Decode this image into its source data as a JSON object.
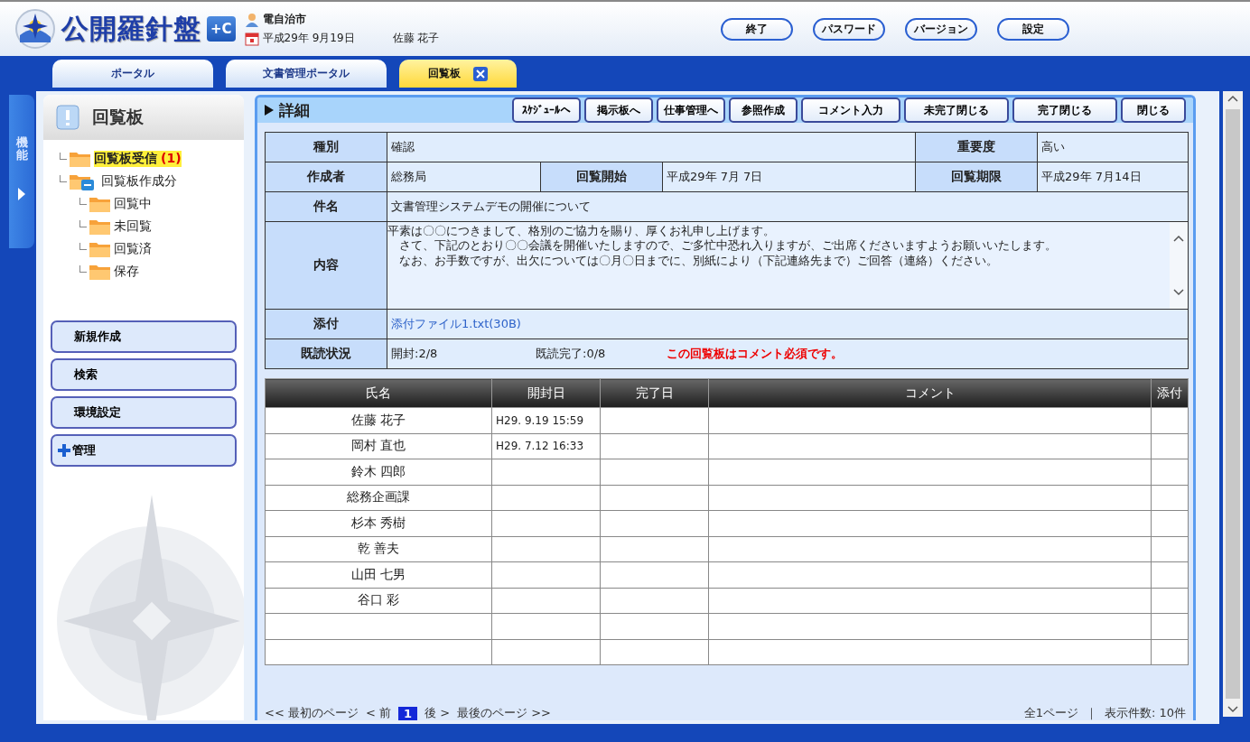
{
  "header": {
    "logo_text": "公開羅針盤",
    "logo_badge": "+C",
    "organization": "電自治市",
    "date": "平成29年 9月19日",
    "user": "佐藤 花子",
    "buttons": [
      "終了",
      "パスワード",
      "バージョン",
      "設定"
    ]
  },
  "tabs": [
    {
      "label": "ポータル",
      "selected": false,
      "closable": false
    },
    {
      "label": "文書管理ポータル",
      "selected": false,
      "closable": false
    },
    {
      "label": "回覧板",
      "selected": true,
      "closable": true
    }
  ],
  "side_strip": {
    "label": "機能"
  },
  "sidebar": {
    "title": "回覧板",
    "tree": [
      {
        "label": "回覧板受信",
        "count": "(1)",
        "highlighted": true
      },
      {
        "label": "回覧板作成分",
        "highlighted": false,
        "expanded": true,
        "children": [
          {
            "label": "回覧中",
            "highlighted": false
          },
          {
            "label": "未回覧",
            "highlighted": false
          },
          {
            "label": "回覧済",
            "highlighted": false
          },
          {
            "label": "保存",
            "highlighted": false
          }
        ]
      }
    ],
    "buttons": [
      {
        "label": "新規作成",
        "kind": "plain"
      },
      {
        "label": "検索",
        "kind": "plain"
      },
      {
        "label": "環境設定",
        "kind": "plain"
      },
      {
        "label": "管理",
        "kind": "expand"
      }
    ]
  },
  "detail": {
    "title": "詳細",
    "buttons": [
      "ｽｹｼﾞｭｰﾙへ",
      "掲示板へ",
      "仕事管理へ",
      "参照作成",
      "コメント入力",
      "未完了閉じる",
      "完了閉じる",
      "閉じる"
    ],
    "fields": {
      "category": {
        "label": "種別",
        "value": "確認"
      },
      "importance": {
        "label": "重要度",
        "value": "高い"
      },
      "creator": {
        "label": "作成者",
        "value": "総務局"
      },
      "start": {
        "label": "回覧開始",
        "value": "平成29年 7月 7日"
      },
      "deadline": {
        "label": "回覧期限",
        "value": "平成29年 7月14日"
      },
      "subject": {
        "label": "件名",
        "value": "文書管理システムデモの開催について"
      },
      "content": {
        "label": "内容",
        "lines": [
          "平素は〇〇につきまして、格別のご協力を賜り、厚くお礼申し上げます。",
          "　さて、下記のとおり〇〇会議を開催いたしますので、ご多忙中恐れ入りますが、ご出席くださいますようお願いいたします。",
          "　なお、お手数ですが、出欠については〇月〇日までに、別紙により（下記連絡先まで）ご回答（連絡）ください。"
        ]
      },
      "attachment": {
        "label": "添付",
        "link": "添付ファイル1.txt(30B)"
      },
      "read_status": {
        "label": "既読状況",
        "opened": "開封:2/8",
        "completed": "既読完了:0/8",
        "notice": "この回覧板はコメント必須です。"
      }
    }
  },
  "table": {
    "columns": [
      "氏名",
      "開封日",
      "完了日",
      "コメント",
      "添付"
    ],
    "rows": [
      {
        "name": "佐藤 花子",
        "opened": "H29. 9.19 15:59"
      },
      {
        "name": "岡村 直也",
        "opened": "H29. 7.12 16:33"
      },
      {
        "name": "鈴木 四郎"
      },
      {
        "name": "総務企画課"
      },
      {
        "name": "杉本 秀樹"
      },
      {
        "name": "乾 善夫"
      },
      {
        "name": "山田 七男"
      },
      {
        "name": "谷口 彩"
      }
    ]
  },
  "pagination": {
    "first": "<< 最初のページ",
    "prev": "< 前",
    "pages": [
      {
        "label": "1",
        "selected": true
      }
    ],
    "next": "後 >",
    "last": "最後のページ >>",
    "total": "全1ページ",
    "separator": "｜",
    "per_page": "表示件数: 10件"
  }
}
